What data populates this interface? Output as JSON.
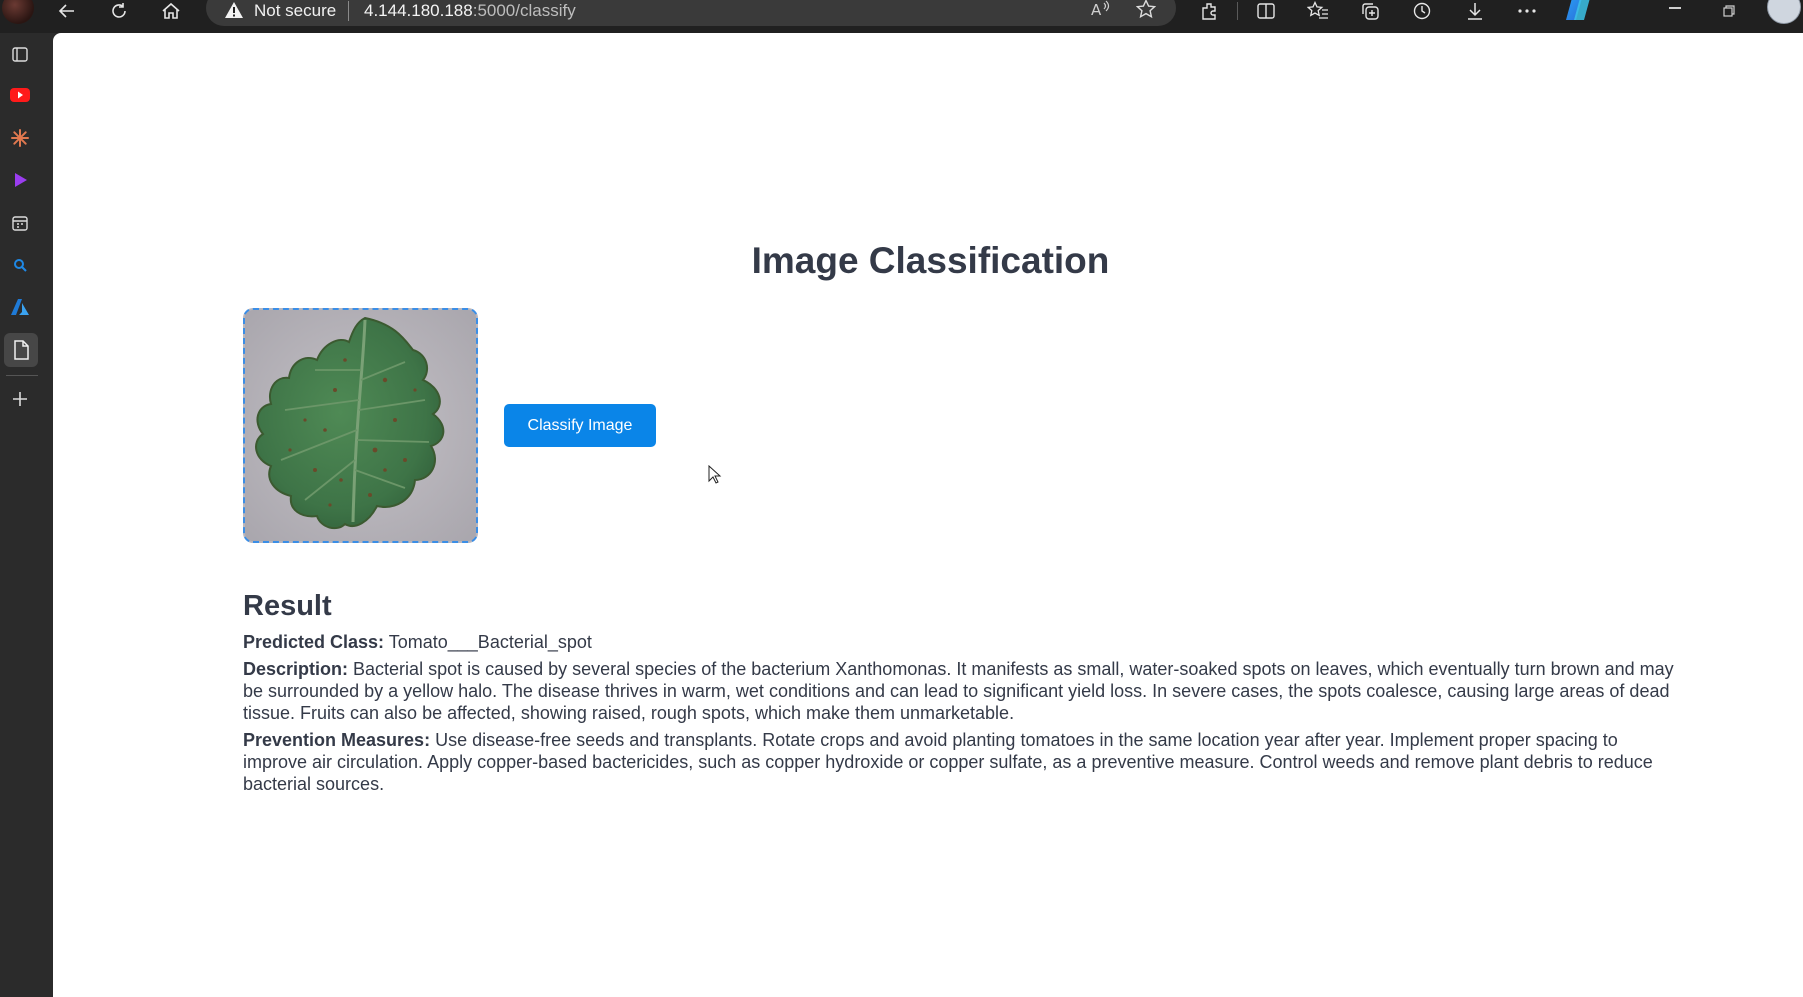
{
  "browser": {
    "security_label": "Not secure",
    "url_host": "4.144.180.188",
    "url_path": ":5000/classify"
  },
  "page": {
    "title": "Image Classification",
    "image_alt": "tomato leaf with bacterial spots",
    "classify_button_label": "Classify Image"
  },
  "result": {
    "heading": "Result",
    "predicted_class_label": "Predicted Class:",
    "predicted_class_value": "Tomato___Bacterial_spot",
    "description_label": "Description:",
    "description_value": "Bacterial spot is caused by several species of the bacterium Xanthomonas. It manifests as small, water-soaked spots on leaves, which eventually turn brown and may be surrounded by a yellow halo. The disease thrives in warm, wet conditions and can lead to significant yield loss. In severe cases, the spots coalesce, causing large areas of dead tissue. Fruits can also be affected, showing raised, rough spots, which make them unmarketable.",
    "prevention_label": "Prevention Measures:",
    "prevention_value": "Use disease-free seeds and transplants. Rotate crops and avoid planting tomatoes in the same location year after year. Implement proper spacing to improve air circulation. Apply copper-based bactericides, such as copper hydroxide or copper sulfate, as a preventive measure. Control weeds and remove plant debris to reduce bacterial sources."
  },
  "colors": {
    "button_bg": "#0a85e8",
    "text": "#343a48",
    "dropzone_border": "#3b8ee6"
  },
  "icons": {
    "toolbar": [
      "back-icon",
      "refresh-icon",
      "home-icon",
      "read-aloud-icon",
      "favorite-star-icon",
      "extensions-icon",
      "split-screen-icon",
      "favorites-icon",
      "collections-icon",
      "history-icon",
      "downloads-icon",
      "more-icon",
      "copilot-icon"
    ],
    "sidebar": [
      "tabs-icon",
      "youtube-icon",
      "claude-icon",
      "video-icon",
      "calendar-icon",
      "search-icon",
      "azure-icon",
      "document-icon",
      "add-icon"
    ]
  }
}
